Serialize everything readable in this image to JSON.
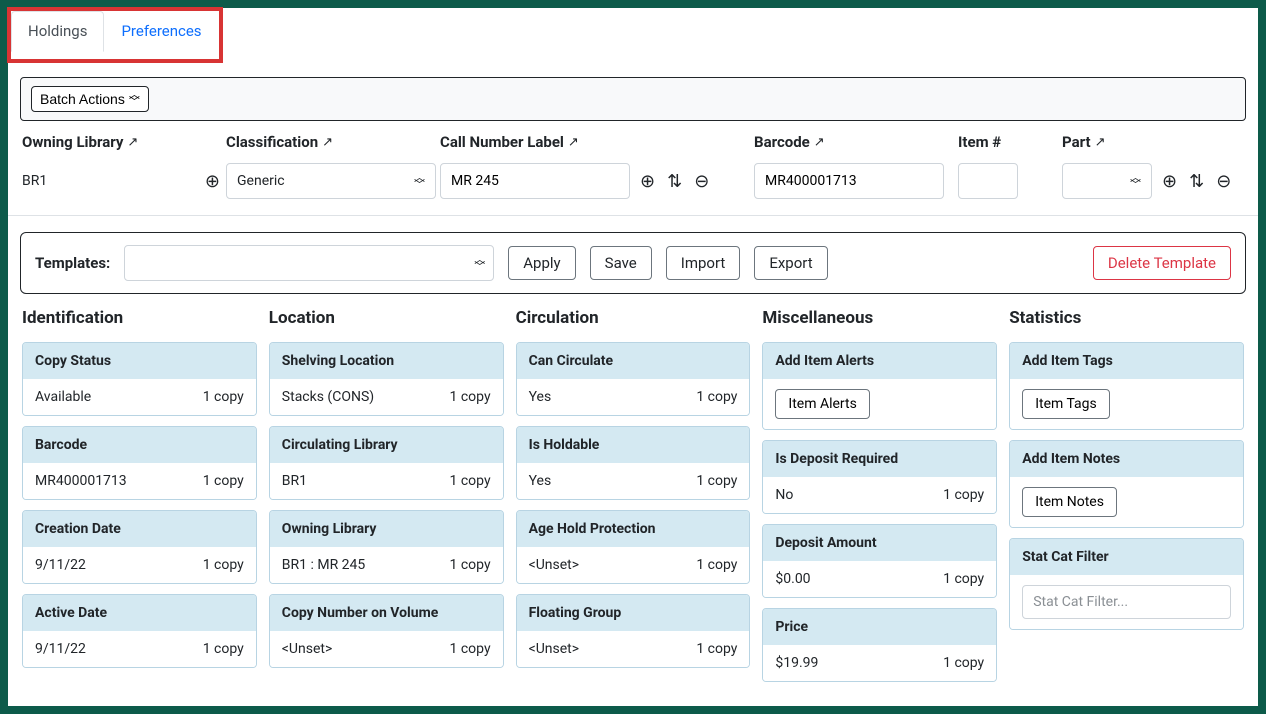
{
  "tabs": {
    "holdings": "Holdings",
    "preferences": "Preferences"
  },
  "batch_actions_label": "Batch Actions",
  "headers": {
    "owning_library": "Owning Library",
    "classification": "Classification",
    "call_number_label": "Call Number Label",
    "barcode": "Barcode",
    "item_num": "Item #",
    "part": "Part"
  },
  "row": {
    "owning_library": "BR1",
    "classification": "Generic",
    "call_number": "MR 245",
    "barcode": "MR400001713",
    "item_num": "",
    "part": ""
  },
  "templates_label": "Templates:",
  "buttons": {
    "apply": "Apply",
    "save": "Save",
    "import": "Import",
    "export": "Export",
    "delete_template": "Delete Template"
  },
  "sections": {
    "identification": {
      "title": "Identification",
      "items": [
        {
          "label": "Copy Status",
          "value": "Available",
          "count": "1 copy"
        },
        {
          "label": "Barcode",
          "value": "MR400001713",
          "count": "1 copy"
        },
        {
          "label": "Creation Date",
          "value": "9/11/22",
          "count": "1 copy"
        },
        {
          "label": "Active Date",
          "value": "9/11/22",
          "count": "1 copy"
        }
      ]
    },
    "location": {
      "title": "Location",
      "items": [
        {
          "label": "Shelving Location",
          "value": "Stacks (CONS)",
          "count": "1 copy"
        },
        {
          "label": "Circulating Library",
          "value": "BR1",
          "count": "1 copy"
        },
        {
          "label": "Owning Library",
          "value": "BR1 : MR 245",
          "count": "1 copy"
        },
        {
          "label": "Copy Number on Volume",
          "value": "<Unset>",
          "count": "1 copy"
        }
      ]
    },
    "circulation": {
      "title": "Circulation",
      "items": [
        {
          "label": "Can Circulate",
          "value": "Yes",
          "count": "1 copy"
        },
        {
          "label": "Is Holdable",
          "value": "Yes",
          "count": "1 copy"
        },
        {
          "label": "Age Hold Protection",
          "value": "<Unset>",
          "count": "1 copy"
        },
        {
          "label": "Floating Group",
          "value": "<Unset>",
          "count": "1 copy"
        }
      ]
    },
    "misc": {
      "title": "Miscellaneous",
      "add_alerts_label": "Add Item Alerts",
      "item_alerts_btn": "Item Alerts",
      "items": [
        {
          "label": "Is Deposit Required",
          "value": "No",
          "count": "1 copy"
        },
        {
          "label": "Deposit Amount",
          "value": "$0.00",
          "count": "1 copy"
        },
        {
          "label": "Price",
          "value": "$19.99",
          "count": "1 copy"
        }
      ]
    },
    "stats": {
      "title": "Statistics",
      "add_tags_label": "Add Item Tags",
      "item_tags_btn": "Item Tags",
      "add_notes_label": "Add Item Notes",
      "item_notes_btn": "Item Notes",
      "stat_cat_filter_label": "Stat Cat Filter",
      "stat_cat_filter_placeholder": "Stat Cat Filter..."
    }
  }
}
